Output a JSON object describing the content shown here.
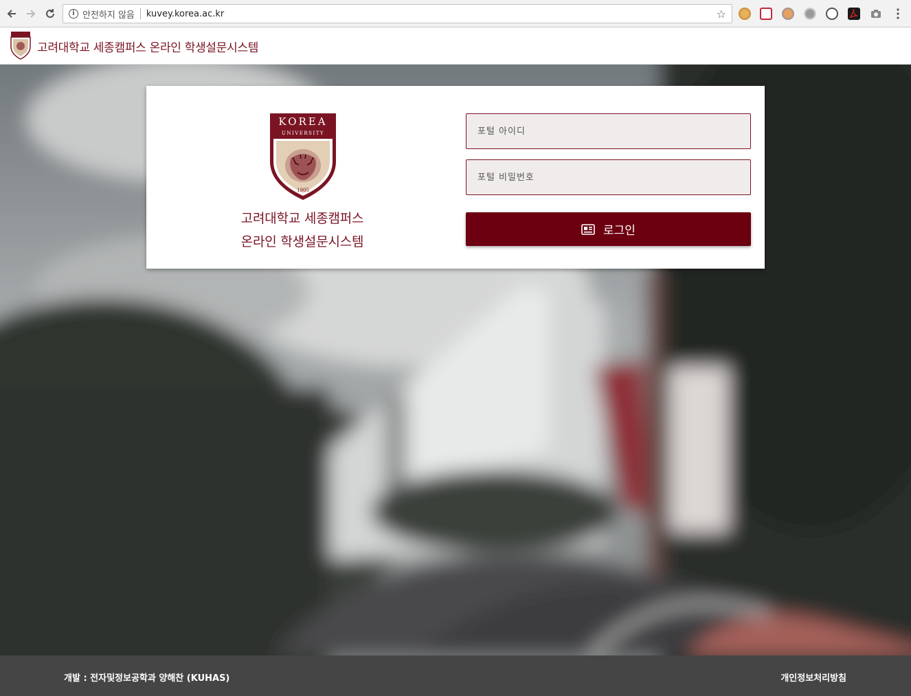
{
  "browser": {
    "security_label": "안전하지 않음",
    "url": "kuvey.korea.ac.kr",
    "info_icon": "info-icon",
    "star_icon": "bookmark-star-icon"
  },
  "header": {
    "title": "고려대학교 세종캠퍼스 온라인 학생설문시스템",
    "logo_text": "KOREA"
  },
  "login": {
    "emblem": {
      "top_text": "KOREA",
      "sub_text": "UNIVERSITY",
      "year": "1905"
    },
    "title_line1": "고려대학교 세종캠퍼스",
    "title_line2": "온라인 학생설문시스템",
    "id_placeholder": "포털 아이디",
    "pw_placeholder": "포털 비밀번호",
    "button_label": "로그인",
    "button_icon": "id-card-icon"
  },
  "footer": {
    "developer": "개발 : 전자및정보공학과 양해찬 (KUHAS)",
    "privacy_link": "개인정보처리방침"
  },
  "colors": {
    "brand": "#7a1423",
    "button": "#6d0010",
    "field_bg": "#f1ecec",
    "footer_bg": "#454545"
  }
}
